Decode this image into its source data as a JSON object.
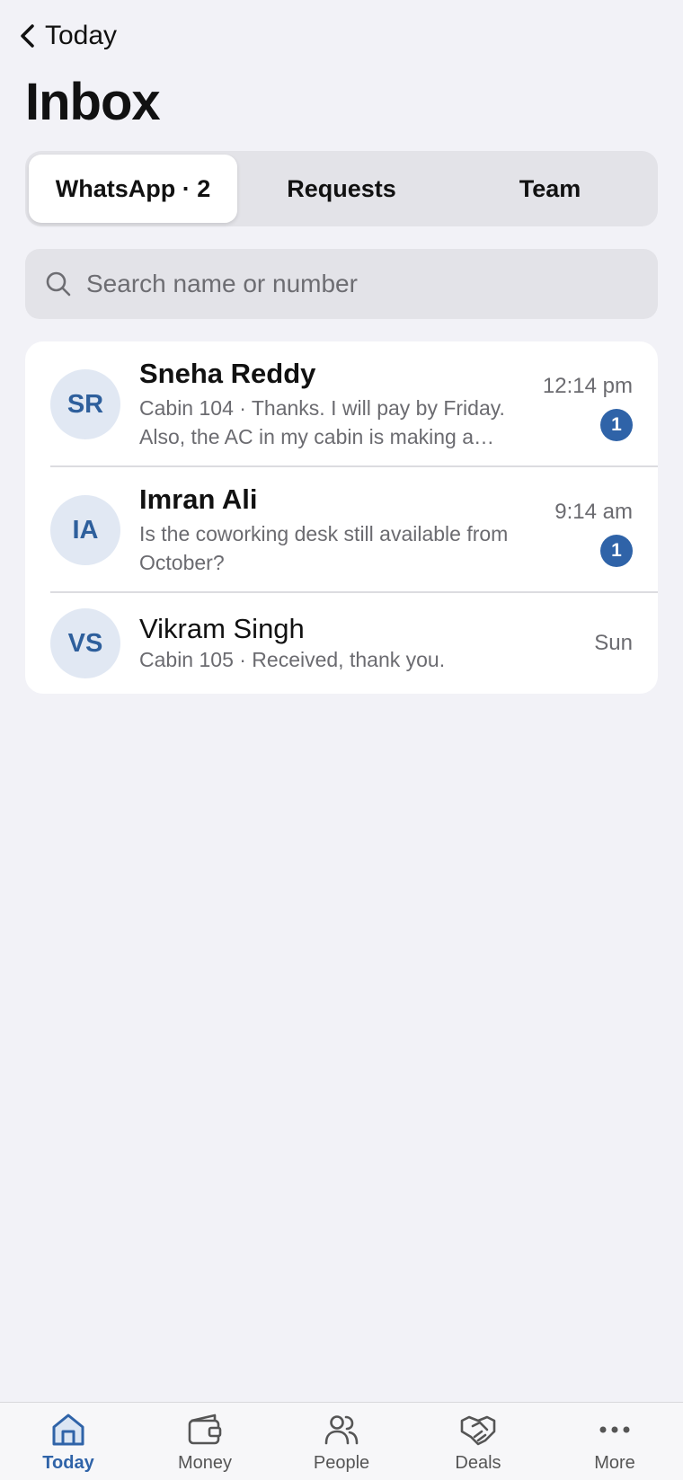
{
  "header": {
    "back_label": "Today",
    "title": "Inbox"
  },
  "segments": [
    {
      "label": "WhatsApp · 2",
      "active": true
    },
    {
      "label": "Requests",
      "active": false
    },
    {
      "label": "Team",
      "active": false
    }
  ],
  "search": {
    "placeholder": "Search name or number",
    "value": ""
  },
  "conversations": [
    {
      "initials": "SR",
      "name": "Sneha Reddy",
      "preview": "Cabin 104 · Thanks. I will pay by Friday. Also, the AC in my cabin is making a…",
      "time": "12:14 pm",
      "unread": "1"
    },
    {
      "initials": "IA",
      "name": "Imran Ali",
      "preview": "Is the coworking desk still available from October?",
      "time": "9:14 am",
      "unread": "1"
    },
    {
      "initials": "VS",
      "name": "Vikram Singh",
      "preview": "Cabin 105 · Received, thank you.",
      "time": "Sun",
      "unread": ""
    }
  ],
  "tabbar": [
    {
      "label": "Today",
      "icon": "home-icon",
      "active": true
    },
    {
      "label": "Money",
      "icon": "wallet-icon",
      "active": false
    },
    {
      "label": "People",
      "icon": "people-icon",
      "active": false
    },
    {
      "label": "Deals",
      "icon": "handshake-icon",
      "active": false
    },
    {
      "label": "More",
      "icon": "more-icon",
      "active": false
    }
  ],
  "colors": {
    "accent": "#2f63a8",
    "background": "#f2f2f7",
    "avatar_bg": "#e1e8f3"
  }
}
